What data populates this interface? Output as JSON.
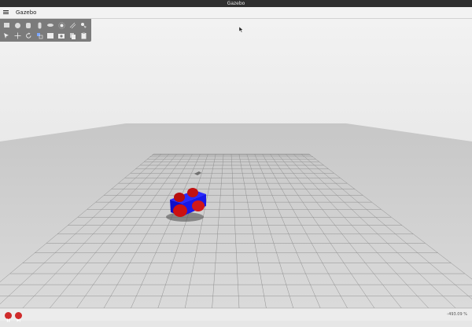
{
  "window": {
    "title": "Gazebo"
  },
  "menubar": {
    "app_name": "Gazebo",
    "menu_icon": "hamburger-menu-icon"
  },
  "toolbar": {
    "row1": [
      "box-shape-icon",
      "sphere-shape-icon",
      "cylinder-shape-icon",
      "capsule-shape-icon",
      "ellipsoid-shape-icon",
      "point-light-icon",
      "directional-light-icon",
      "spot-light-icon"
    ],
    "row2": [
      "select-arrow-icon",
      "translate-icon",
      "rotate-icon",
      "scale-icon",
      "screenshot-icon",
      "camera-icon",
      "copy-icon",
      "paste-icon"
    ]
  },
  "playback": {
    "play_pause_icon": "pause-icon",
    "step_icon": "step-forward-icon",
    "zoom_text": "493.09 %"
  },
  "colors": {
    "robot_body": "#1010dd",
    "robot_wheels": "#cc1010",
    "play_button": "#cf2b2b",
    "toolbar_bg": "#7b7b7b"
  }
}
